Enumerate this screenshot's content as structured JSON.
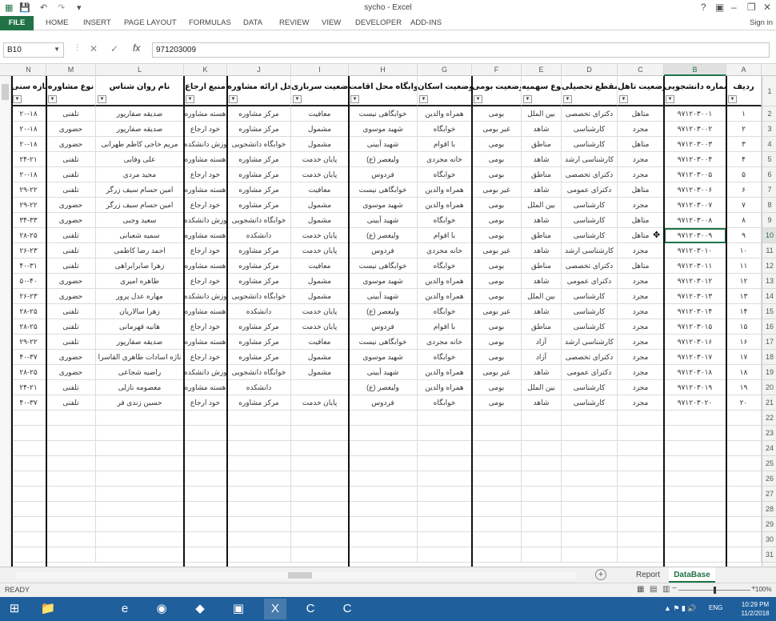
{
  "app": {
    "title": "sycho - Excel",
    "signin": "Sign in",
    "colors": {
      "excel_green": "#217346",
      "taskbar": "#1f5f9c"
    }
  },
  "ribbon_tabs": [
    "FILE",
    "HOME",
    "INSERT",
    "PAGE LAYOUT",
    "FORMULAS",
    "DATA",
    "REVIEW",
    "VIEW",
    "DEVELOPER",
    "ADD-INS"
  ],
  "formula_bar": {
    "name_box": "B10",
    "fx_label": "fx",
    "value": "971203009"
  },
  "columns": [
    "N",
    "M",
    "L",
    "K",
    "J",
    "I",
    "H",
    "G",
    "F",
    "E",
    "D",
    "C",
    "B",
    "A"
  ],
  "selected_column": "B",
  "selected_row": 10,
  "headers": [
    "بازه سنی",
    "نوع مشاوره",
    "نام روان شناس",
    "منبع ارجاع",
    "محل ارائه مشاوره",
    "وضعیت سربازی",
    "خوابگاه محل اقامت",
    "وضعیت اسکان",
    "وضعیت بومی",
    "نوع سهمیه",
    "مقطع تحصیلی",
    "وضعیت تاهل",
    "شماره دانشجویی",
    "ردیف"
  ],
  "rows": [
    [
      "۲۰-۱۸",
      "تلفنی",
      "صدیقه صفارپور",
      "هسته مشاوره",
      "مرکز مشاوره",
      "معافیت",
      "خوابگاهی نیست",
      "همراه والدین",
      "بومی",
      "بین الملل",
      "دکترای تخصصی",
      "متاهل",
      "۹۷۱۲۰۳۰۰۱",
      "۱"
    ],
    [
      "۲۰-۱۸",
      "حضوری",
      "صدیقه صفارپور",
      "خود ارجاع",
      "مرکز مشاوره",
      "مشمول",
      "شهید موسوی",
      "خوابگاه",
      "غیر بومی",
      "شاهد",
      "کارشناسی",
      "مجرد",
      "۹۷۱۲۰۳۰۰۲",
      "۲"
    ],
    [
      "۲۰-۱۸",
      "حضوری",
      "مریم خاجی کاظم طهرانی",
      "آموزش دانشکده",
      "خوابگاه دانشجویی",
      "مشمول",
      "شهید آیینی",
      "با اقوام",
      "بومی",
      "مناطق",
      "کارشناسی",
      "متاهل",
      "۹۷۱۲۰۳۰۰۳",
      "۳"
    ],
    [
      "۲۴-۲۱",
      "تلفنی",
      "علی وفایی",
      "هسته مشاوره",
      "مرکز مشاوره",
      "پایان خدمت",
      "ولیعصر (ع)",
      "خانه مجردی",
      "بومی",
      "شاهد",
      "کارشناسی ارشد",
      "مجرد",
      "۹۷۱۲۰۳۰۰۴",
      "۴"
    ],
    [
      "۲۰-۱۸",
      "تلفنی",
      "مجید مردی",
      "خود ارجاع",
      "مرکز مشاوره",
      "پایان خدمت",
      "فردوس",
      "خوابگاه",
      "بومی",
      "مناطق",
      "دکترای تخصصی",
      "مجرد",
      "۹۷۱۲۰۳۰۰۵",
      "۵"
    ],
    [
      "۲۹-۲۲",
      "تلفنی",
      "امین حسام سیف زرگر",
      "هسته مشاوره",
      "مرکز مشاوره",
      "معافیت",
      "خوابگاهی نیست",
      "همراه والدین",
      "غیر بومی",
      "شاهد",
      "دکترای عمومی",
      "متاهل",
      "۹۷۱۲۰۳۰۰۶",
      "۶"
    ],
    [
      "۲۹-۲۲",
      "حضوری",
      "امین حسام سیف زرگر",
      "خود ارجاع",
      "مرکز مشاوره",
      "مشمول",
      "شهید موسوی",
      "همراه والدین",
      "بومی",
      "بین الملل",
      "کارشناسی",
      "مجرد",
      "۹۷۱۲۰۳۰۰۷",
      "۷"
    ],
    [
      "۳۴-۳۳",
      "حضوری",
      "سعید وجبی",
      "آموزش دانشکده",
      "خوابگاه دانشجویی",
      "مشمول",
      "شهید آیینی",
      "خوابگاه",
      "بومی",
      "شاهد",
      "کارشناسی",
      "متاهل",
      "۹۷۱۲۰۳۰۰۸",
      "۸"
    ],
    [
      "۲۸-۲۵",
      "تلفنی",
      "سمیه شعبانی",
      "هسته مشاوره",
      "دانشکده",
      "پایان خدمت",
      "ولیعصر (ع)",
      "با اقوام",
      "بومی",
      "مناطق",
      "کارشناسی",
      "متاهل",
      "۹۷۱۲۰۳۰۰۹",
      "۹"
    ],
    [
      "۲۶-۲۳",
      "تلفنی",
      "احمد رضا کاظمی",
      "خود ارجاع",
      "مرکز مشاوره",
      "پایان خدمت",
      "فردوس",
      "خانه مجردی",
      "غیر بومی",
      "شاهد",
      "کارشناسی ارشد",
      "مجرد",
      "۹۷۱۲۰۳۰۱۰",
      "۱۰"
    ],
    [
      "۴۰-۳۱",
      "تلفنی",
      "زهرا صابرابراهی",
      "هسته مشاوره",
      "مرکز مشاوره",
      "معافیت",
      "خوابگاهی نیست",
      "خوابگاه",
      "بومی",
      "مناطق",
      "دکترای تخصصی",
      "متاهل",
      "۹۷۱۲۰۳۰۱۱",
      "۱۱"
    ],
    [
      "۵۰-۴۰",
      "حضوری",
      "طاهره امیری",
      "خود ارجاع",
      "مرکز مشاوره",
      "مشمول",
      "شهید موسوی",
      "همراه والدین",
      "بومی",
      "شاهد",
      "دکترای عمومی",
      "مجرد",
      "۹۷۱۲۰۳۰۱۲",
      "۱۲"
    ],
    [
      "۲۶-۲۳",
      "حضوری",
      "مهاره عدل پرور",
      "آموزش دانشکده",
      "خوابگاه دانشجویی",
      "مشمول",
      "شهید آیینی",
      "همراه والدین",
      "بومی",
      "بین الملل",
      "کارشناسی",
      "مجرد",
      "۹۷۱۲۰۳۰۱۳",
      "۱۳"
    ],
    [
      "۲۸-۲۵",
      "تلفنی",
      "زهرا سالاریان",
      "هسته مشاوره",
      "دانشکده",
      "پایان خدمت",
      "ولیعصر (ع)",
      "خوابگاه",
      "غیر بومی",
      "شاهد",
      "کارشناسی",
      "مجرد",
      "۹۷۱۲۰۳۰۱۴",
      "۱۴"
    ],
    [
      "۲۸-۲۵",
      "تلفنی",
      "هانیه قهرمانی",
      "خود ارجاع",
      "مرکز مشاوره",
      "پایان خدمت",
      "فردوس",
      "با اقوام",
      "بومی",
      "مناطق",
      "کارشناسی",
      "مجرد",
      "۹۷۱۲۰۳۰۱۵",
      "۱۵"
    ],
    [
      "۲۹-۲۲",
      "تلفنی",
      "صدیقه صفارپور",
      "هسته مشاوره",
      "مرکز مشاوره",
      "معافیت",
      "خوابگاهی نیست",
      "خانه مجردی",
      "بومی",
      "آزاد",
      "کارشناسی ارشد",
      "مجرد",
      "۹۷۱۲۰۳۰۱۶",
      "۱۶"
    ],
    [
      "۴۰-۳۷",
      "حضوری",
      "ناژه اسادات طاهری القاسرا",
      "خود ارجاع",
      "مرکز مشاوره",
      "مشمول",
      "شهید موسوی",
      "خوابگاه",
      "بومی",
      "آزاد",
      "دکترای تخصصی",
      "مجرد",
      "۹۷۱۲۰۳۰۱۷",
      "۱۷"
    ],
    [
      "۲۸-۲۵",
      "حضوری",
      "راضیه شجاعی",
      "آموزش دانشکده",
      "خوابگاه دانشجویی",
      "مشمول",
      "شهید آیینی",
      "همراه والدین",
      "غیر بومی",
      "شاهد",
      "دکترای عمومی",
      "مجرد",
      "۹۷۱۲۰۳۰۱۸",
      "۱۸"
    ],
    [
      "۲۴-۲۱",
      "تلفنی",
      "معصومه نازلی",
      "هسته مشاوره",
      "دانشکده",
      "",
      "ولیعصر (ع)",
      "همراه والدین",
      "بومی",
      "بین الملل",
      "کارشناسی",
      "مجرد",
      "۹۷۱۲۰۳۰۱۹",
      "۱۹"
    ],
    [
      "۴۰-۳۷",
      "تلفنی",
      "حسین زندی فر",
      "خود ارجاع",
      "مرکز مشاوره",
      "پایان خدمت",
      "فردوس",
      "خوابگاه",
      "بومی",
      "شاهد",
      "کارشناسی",
      "مجرد",
      "۹۷۱۲۰۳۰۲۰",
      "۲۰"
    ]
  ],
  "row_numbers": [
    "1",
    "2",
    "3",
    "4",
    "5",
    "6",
    "7",
    "8",
    "9",
    "10",
    "11",
    "12",
    "13",
    "14",
    "15",
    "16",
    "17",
    "18",
    "19",
    "20",
    "21",
    "22",
    "23",
    "24",
    "25",
    "26",
    "27",
    "28",
    "29",
    "30",
    "31"
  ],
  "sheet_tabs": [
    "Report",
    "DataBase"
  ],
  "active_sheet": "DataBase",
  "status": {
    "ready": "READY",
    "zoom": "100%"
  },
  "taskbar": {
    "icons": [
      "windows-start-icon",
      "file-explorer-icon",
      "internet-explorer-icon",
      "firefox-icon",
      "layers-icon",
      "image-viewer-icon",
      "excel-icon",
      "camtasia-recorder-icon",
      "camtasia-studio-icon"
    ],
    "lang": "ENG",
    "time": "10:29 PM",
    "date": "11/2/2018"
  }
}
